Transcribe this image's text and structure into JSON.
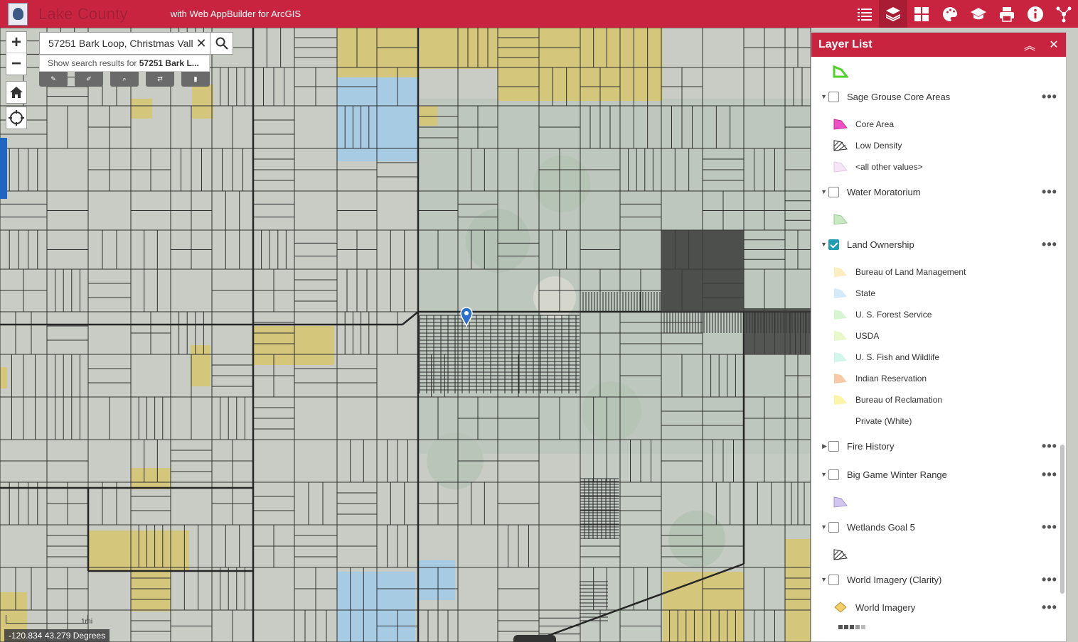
{
  "header": {
    "app_title": "Lake County",
    "subtitle": "with Web AppBuilder for ArcGIS",
    "icons": [
      "legend-list-icon",
      "layers-icon",
      "basemap-gallery-icon",
      "theme-icon",
      "education-icon",
      "print-icon",
      "info-icon",
      "share-icon"
    ]
  },
  "colors": {
    "brand": "#c8243f",
    "blm": "#d4c77c",
    "state": "#a7cbe3"
  },
  "search": {
    "value": "57251 Bark Loop, Christmas Vall",
    "clear": "✕",
    "suggest_prefix": "Show search results for ",
    "suggest_bold": "57251 Bark L..."
  },
  "zoom": {
    "in": "+",
    "out": "−"
  },
  "panel": {
    "title": "Layer List",
    "collapse": "︽",
    "close": "✕",
    "layers": [
      {
        "label": "Sage Grouse Core Areas",
        "checked": false
      },
      {
        "label": "Water Moratorium",
        "checked": false
      },
      {
        "label": "Land Ownership",
        "checked": true
      },
      {
        "label": "Fire History",
        "checked": false
      },
      {
        "label": "Big Game Winter Range",
        "checked": false
      },
      {
        "label": "Wetlands Goal 5",
        "checked": false
      },
      {
        "label": "World Imagery (Clarity)",
        "checked": false
      }
    ],
    "legend": {
      "sage": [
        "Core Area",
        "Low Density",
        "<all other values>"
      ],
      "land": [
        "Bureau of Land Management",
        "State",
        "U. S. Forest Service",
        "USDA",
        "U. S. Fish and Wildlife",
        "Indian Reservation",
        "Bureau of Reclamation",
        "Private (White)"
      ],
      "imagery": "World Imagery"
    },
    "more": "•••"
  },
  "coords": "-120.834 43.279 Degrees",
  "scale": "1mi"
}
